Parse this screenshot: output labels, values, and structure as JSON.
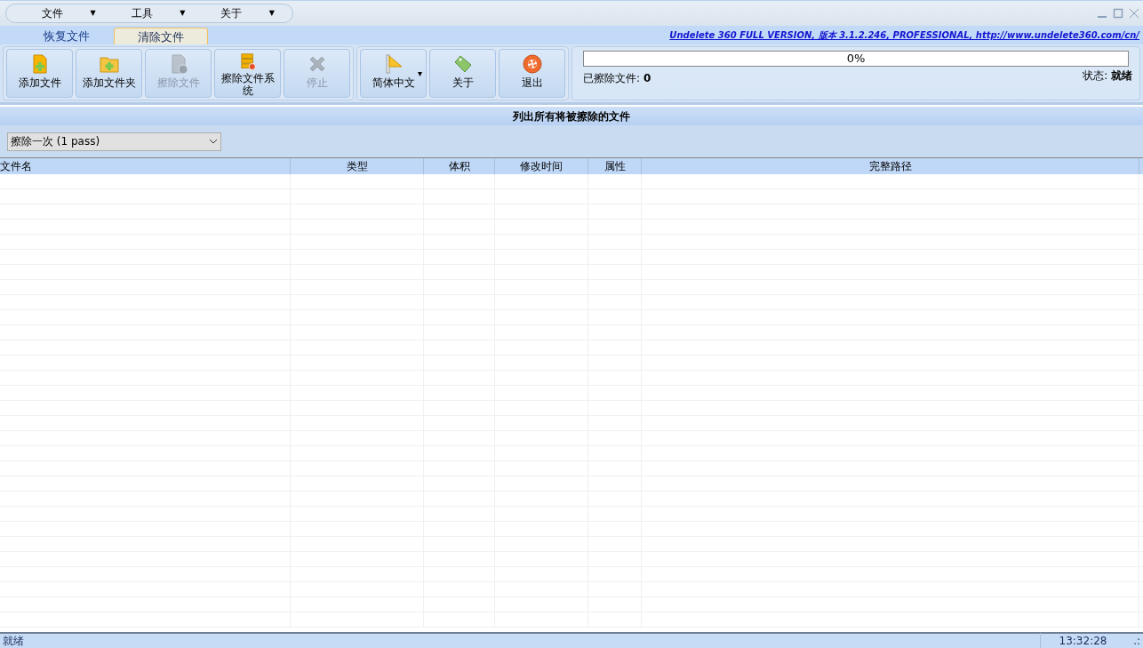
{
  "menu": [
    {
      "label": "文件",
      "arrow": "▼"
    },
    {
      "label": "工具",
      "arrow": "▼"
    },
    {
      "label": "关于",
      "arrow": "▼"
    }
  ],
  "tabs": [
    {
      "label": "恢复文件",
      "selected": false
    },
    {
      "label": "清除文件",
      "selected": true
    }
  ],
  "version_link": "Undelete 360 FULL VERSION, 版本 3.1.2.246, PROFESSIONAL, http://www.undelete360.com/cn/",
  "toolbar_groups": [
    [
      {
        "kind": "add-file",
        "label": "添加文件",
        "disabled": false
      },
      {
        "kind": "add-folder",
        "label": "添加文件夹",
        "disabled": false
      },
      {
        "kind": "wipe-file",
        "label": "擦除文件",
        "disabled": true
      },
      {
        "kind": "wipe-system",
        "label": "擦除文件系统",
        "disabled": false
      },
      {
        "kind": "stop",
        "label": "停止",
        "disabled": true
      }
    ],
    [
      {
        "kind": "language",
        "label": "简体中文",
        "disabled": false,
        "dropdown": "▾"
      },
      {
        "kind": "about",
        "label": "关于",
        "disabled": false
      },
      {
        "kind": "exit",
        "label": "退出",
        "disabled": false
      }
    ]
  ],
  "progress": {
    "level": 0,
    "reading": "0%"
  },
  "wiped_files": {
    "label": "已擦除文件:",
    "value": "0"
  },
  "status": {
    "label": "状态:",
    "value": "就绪"
  },
  "section_title": "列出所有将被擦除的文件",
  "wipe_mode": {
    "value": "擦除一次 (1 pass)"
  },
  "table": {
    "columns": [
      "文件名",
      "类型",
      "体积",
      "修改时间",
      "属性",
      "完整路径"
    ]
  },
  "status_bar": {
    "message": "就绪",
    "time": "13:32:28",
    "grip": ".:"
  }
}
